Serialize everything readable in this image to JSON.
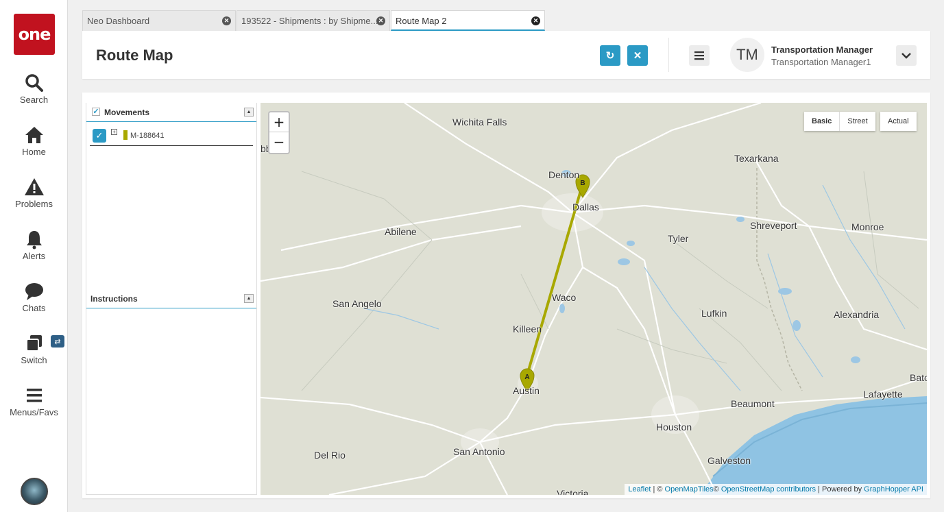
{
  "app": {
    "logo_text": "one"
  },
  "sidebar": {
    "items": [
      {
        "label": "Search"
      },
      {
        "label": "Home"
      },
      {
        "label": "Problems"
      },
      {
        "label": "Alerts"
      },
      {
        "label": "Chats"
      },
      {
        "label": "Switch"
      },
      {
        "label": "Menus/Favs"
      }
    ],
    "switch_badge": "⇄"
  },
  "tabs": [
    {
      "label": "Neo Dashboard"
    },
    {
      "label": "193522 - Shipments : by Shipme..."
    },
    {
      "label": "Route Map 2"
    }
  ],
  "header": {
    "title": "Route Map",
    "refresh_icon": "↻",
    "close_icon": "✕",
    "user_initials": "TM",
    "user_name": "Transportation Manager",
    "user_sub": "Transportation Manager1"
  },
  "left_panel": {
    "movements_title": "Movements",
    "movement": {
      "id": "M-188641",
      "color": "#a8a800"
    },
    "instructions_title": "Instructions"
  },
  "map": {
    "zoom_in": "+",
    "zoom_out": "−",
    "layers": [
      "Basic",
      "Street"
    ],
    "actual_label": "Actual",
    "cities": [
      "Wichita Falls",
      "Denton",
      "Dallas",
      "Texarkana",
      "Abilene",
      "Shreveport",
      "Monroe",
      "Tyler",
      "San Angelo",
      "Waco",
      "Lufkin",
      "Alexandria",
      "Killeen",
      "Austin",
      "Bato",
      "Lafayette",
      "Beaumont",
      "Houston",
      "Del Rio",
      "San Antonio",
      "Galveston",
      "Victoria",
      "bb"
    ],
    "markers": [
      "A",
      "B"
    ],
    "attribution": {
      "leaflet": "Leaflet",
      "sep1": " | © ",
      "omt": "OpenMapTiles",
      "sep2": "© ",
      "osm": "OpenStreetMap contributors",
      "sep3": " | Powered by ",
      "gh": "GraphHopper API"
    }
  }
}
